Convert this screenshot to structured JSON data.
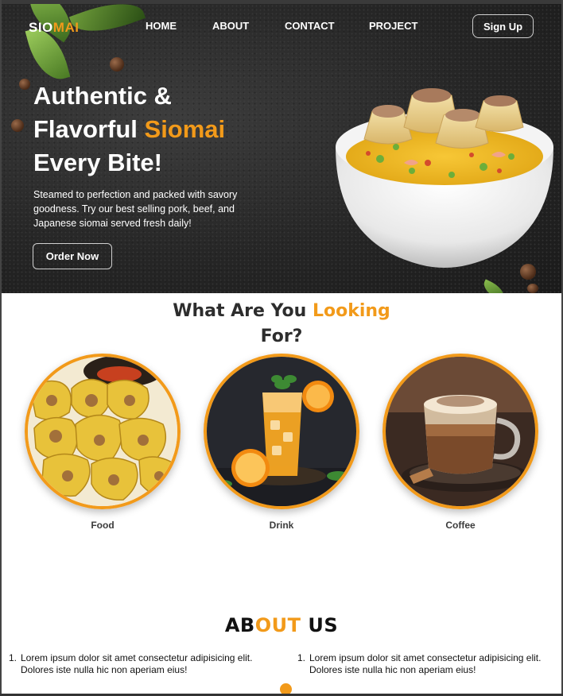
{
  "nav": {
    "logo": {
      "part1": "SIO",
      "part2": "MAI"
    },
    "links": [
      "HOME",
      "ABOUT",
      "CONTACT",
      "PROJECT"
    ],
    "signup_label": "Sign Up"
  },
  "hero": {
    "title_line1": "Authentic &",
    "title_line2_plain": "Flavorful ",
    "title_line2_accent": "Siomai",
    "title_line3": "Every Bite!",
    "description": "Steamed to perfection and packed with savory goodness. Try our best selling pork, beef, and Japanese siomai served fresh daily!",
    "order_label": "Order Now"
  },
  "looking": {
    "title_plain": "What Are You ",
    "title_accent": "Looking",
    "title_line2": "For?",
    "categories": [
      {
        "label": "Food",
        "icon": "siomai-image"
      },
      {
        "label": "Drink",
        "icon": "orange-juice-image"
      },
      {
        "label": "Coffee",
        "icon": "coffee-image"
      }
    ]
  },
  "about": {
    "title_part1": "AB",
    "title_part2": "OUT",
    "title_part3": " US",
    "items_left": [
      "Lorem ipsum dolor sit amet consectetur adipisicing elit. Dolores iste nulla hic non aperiam eius!"
    ],
    "items_right": [
      "Lorem ipsum dolor sit amet consectetur adipisicing elit. Dolores iste nulla hic non aperiam eius!"
    ]
  },
  "colors": {
    "accent": "#f29a1a",
    "hero_bg": "#262626",
    "text_dark": "#2d2d2d"
  }
}
